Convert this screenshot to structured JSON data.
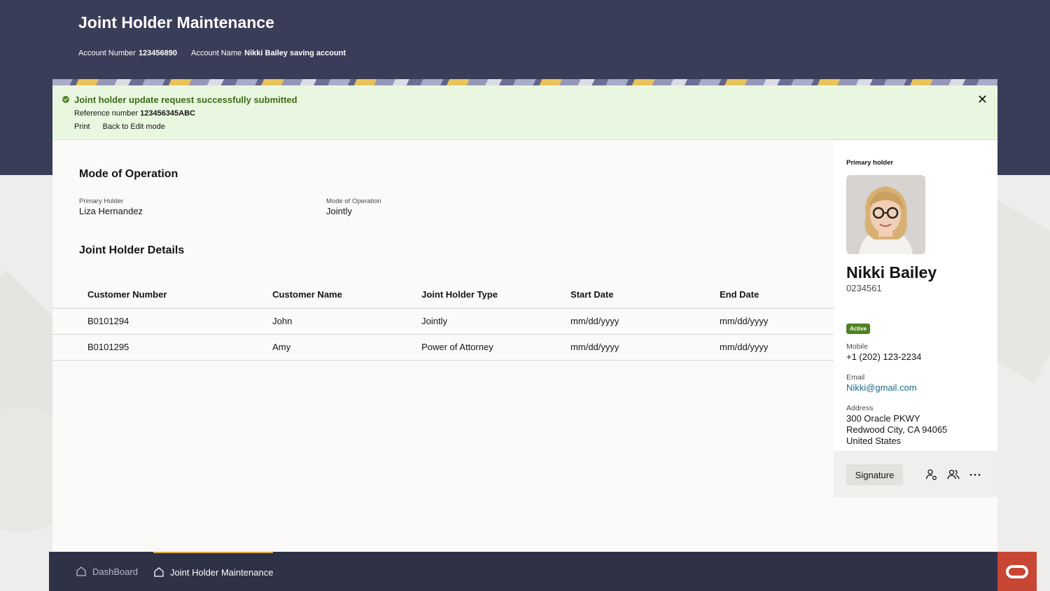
{
  "header": {
    "title": "Joint Holder Maintenance",
    "account_number_label": "Account Number",
    "account_number": "123456890",
    "account_name_label": "Account Name",
    "account_name": "Nikki Bailey saving account"
  },
  "banner": {
    "message": "Joint holder update request successfully submitted",
    "reference_label": "Reference number",
    "reference_number": "123456345ABC",
    "print_label": "Print",
    "back_label": "Back to Edit mode",
    "close_glyph": "✕"
  },
  "mode_section": {
    "title": "Mode of Operation",
    "primary_holder_label": "Primary Holder",
    "primary_holder_value": "Liza Hernandez",
    "mode_label": "Mode of Operation",
    "mode_value": "Jointly"
  },
  "joint_section": {
    "title": "Joint Holder Details",
    "columns": [
      "Customer Number",
      "Customer Name",
      "Joint Holder Type",
      "Start Date",
      "End Date"
    ],
    "rows": [
      [
        "B0101294",
        "John",
        "Jointly",
        "mm/dd/yyyy",
        "mm/dd/yyyy"
      ],
      [
        "B0101295",
        "Amy",
        "Power of Attorney",
        "mm/dd/yyyy",
        "mm/dd/yyyy"
      ]
    ]
  },
  "primary_panel": {
    "label": "Primary holder",
    "name": "Nikki Bailey",
    "customer_id": "0234561",
    "status": "Active",
    "status_color": "#508223",
    "mobile_label": "Mobile",
    "mobile": "+1 (202) 123-2234",
    "email_label": "Email",
    "email": "Nikki@gmail.com",
    "address_label": "Address",
    "address_line1": "300 Oracle PKWY",
    "address_line2": "Redwood City, CA 94065",
    "address_line3": "United States",
    "signature_label": "Signature",
    "icons": [
      "user-settings-icon",
      "users-icon",
      "more-icon"
    ]
  },
  "bottom_nav": {
    "items": [
      {
        "label": "DashBoard",
        "icon": "home-icon",
        "active": false
      },
      {
        "label": "Joint Holder Maintenance",
        "icon": "home-icon",
        "active": true
      }
    ]
  },
  "colors": {
    "header_bg": "#3a3d58",
    "banner_bg": "#e9f7e1",
    "success_text": "#3d6b16",
    "link": "#1d6b87",
    "footer_bg": "#2f3146",
    "active_tab_accent": "#d8a64d",
    "oracle_red": "#c74634"
  }
}
